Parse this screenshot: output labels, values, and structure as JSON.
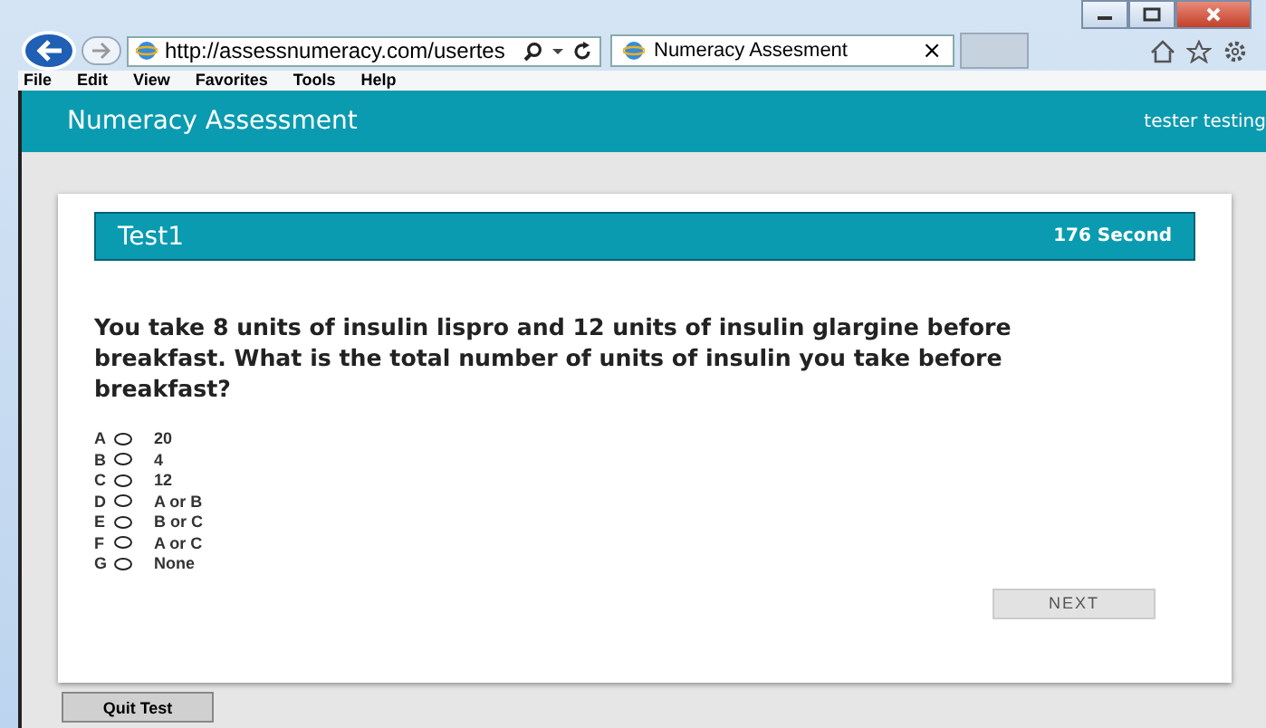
{
  "browser": {
    "address": "http://assessnumeracy.com/usertes",
    "tab_title": "Numeracy Assesment",
    "tab_close": "×",
    "menu": [
      "File",
      "Edit",
      "View",
      "Favorites",
      "Tools",
      "Help"
    ]
  },
  "app_header": {
    "title": "Numeracy Assessment",
    "user": "tester testing"
  },
  "test": {
    "title": "Test1",
    "timer": "176 Second"
  },
  "question": "You take 8 units of insulin lispro and 12 units of insulin glargine before breakfast. What is the total number of units of insulin you take before breakfast?",
  "options": [
    {
      "letter": "A",
      "text": "20",
      "selected": false
    },
    {
      "letter": "B",
      "text": "4",
      "selected": false
    },
    {
      "letter": "C",
      "text": "12",
      "selected": false
    },
    {
      "letter": "D",
      "text": "A or B",
      "selected": false
    },
    {
      "letter": "E",
      "text": "B or C",
      "selected": false
    },
    {
      "letter": "F",
      "text": "A or C",
      "selected": false
    },
    {
      "letter": "G",
      "text": "None",
      "selected": false
    }
  ],
  "next_button": "NEXT",
  "quit_button": "Quit Test"
}
